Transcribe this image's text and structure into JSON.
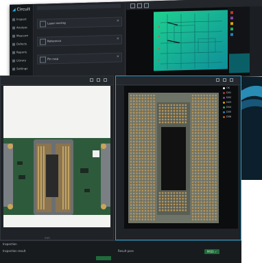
{
  "app": {
    "name_prefix": "Cir",
    "name_suffix": "cuit"
  },
  "sidebar": {
    "items": [
      "Inspect",
      "Analyze",
      "Measure",
      "Defects",
      "Reports",
      "Library",
      "Settings"
    ]
  },
  "mid_panel": {
    "rows": [
      "Layer overlay",
      "Reference",
      "Pin map"
    ]
  },
  "left_view": {
    "axis_label": "mm"
  },
  "right_view": {
    "legend": [
      {
        "label": "OK",
        "color": "#ffffff"
      },
      {
        "label": "D01",
        "color": "#c0392b"
      },
      {
        "label": "D02",
        "color": "#8e44ad"
      },
      {
        "label": "D03",
        "color": "#e0a400"
      },
      {
        "label": "D04",
        "color": "#27ae60"
      },
      {
        "label": "D05",
        "color": "#2980b9"
      },
      {
        "label": "D06",
        "color": "#d35400"
      }
    ]
  },
  "dock": {
    "rows": [
      "Inspection",
      "Inspection result",
      "Result pass"
    ],
    "ok_label": "PASS ✓"
  },
  "colors": {
    "accent": "#1aa6d9",
    "board_green": "#2e5a3c",
    "pin_gold": "#b8955a"
  }
}
